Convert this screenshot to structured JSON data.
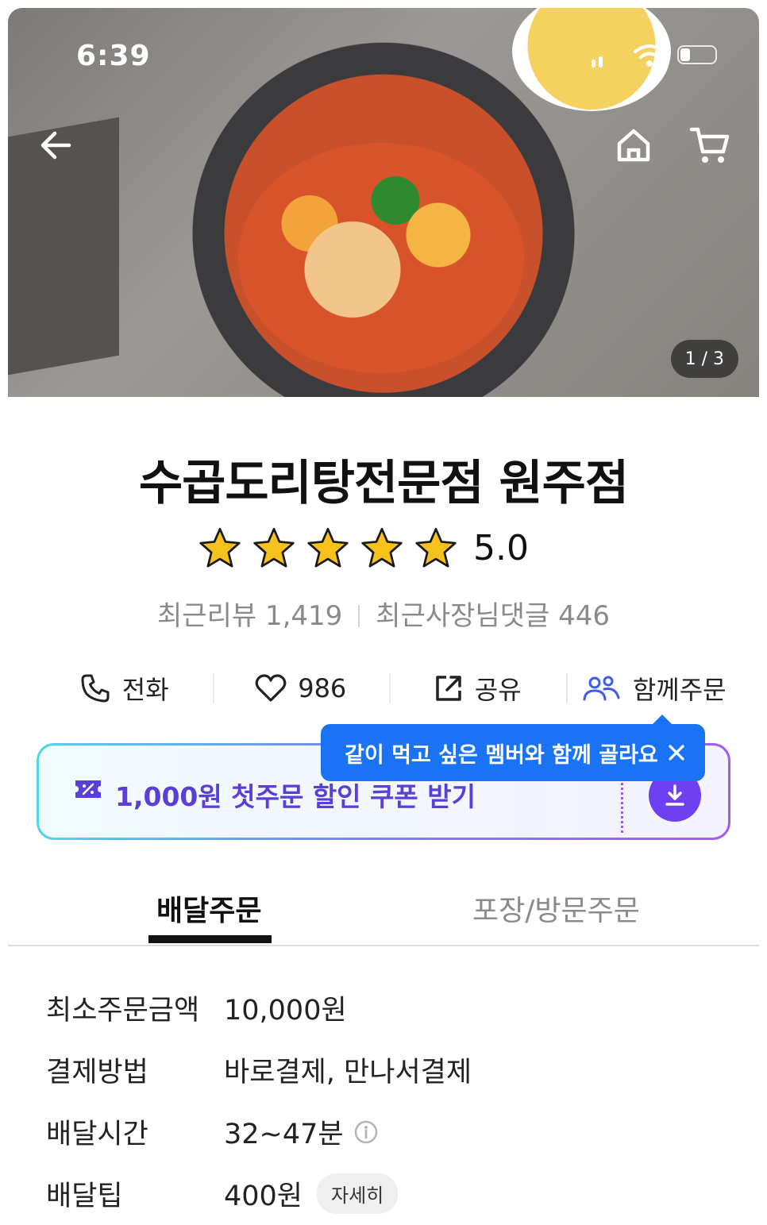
{
  "status_bar": {
    "time": "6:39"
  },
  "hero": {
    "image_counter": "1 / 3"
  },
  "store": {
    "name": "수곱도리탕전문점 원주점",
    "rating": 5.0,
    "rating_label": "5.0",
    "recent_reviews": "최근리뷰 1,419",
    "recent_owner_replies": "최근사장님댓글 446"
  },
  "actions": {
    "call": "전화",
    "like_count": "986",
    "share": "공유",
    "group_order": "함께주문"
  },
  "tooltip": {
    "text": "같이 먹고 싶은 멤버와 함께 골라요"
  },
  "coupon": {
    "label": "1,000원 첫주문 할인 쿠폰 받기"
  },
  "tabs": {
    "delivery": "배달주문",
    "pickup": "포장/방문주문",
    "active": "delivery"
  },
  "info": {
    "min_order_label": "최소주문금액",
    "min_order_value": "10,000원",
    "payment_label": "결제방법",
    "payment_value": "바로결제, 만나서결제",
    "delivery_time_label": "배달시간",
    "delivery_time_value": "32~47분",
    "delivery_tip_label": "배달팁",
    "delivery_tip_value": "400원",
    "detail_button": "자세히"
  },
  "colors": {
    "accent_purple": "#6f3ff2",
    "tooltip_blue": "#1a73f5",
    "group_order_icon": "#3d5af1",
    "star": "#f7c21b"
  },
  "icons": [
    "back-arrow-icon",
    "home-icon",
    "cart-icon",
    "phone-icon",
    "heart-icon",
    "share-icon",
    "group-icon",
    "close-icon",
    "ticket-icon",
    "download-icon",
    "info-icon",
    "star-icon"
  ]
}
